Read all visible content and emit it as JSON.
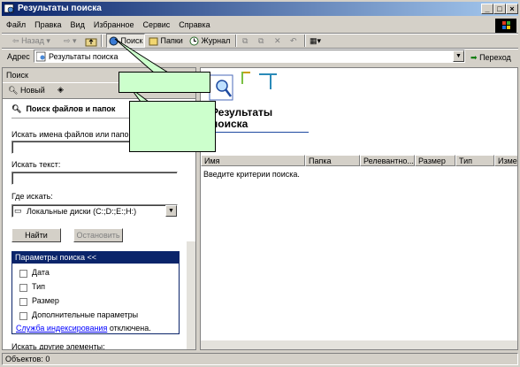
{
  "window": {
    "title": "Результаты поиска"
  },
  "menu": [
    "Файл",
    "Правка",
    "Вид",
    "Избранное",
    "Сервис",
    "Справка"
  ],
  "toolbar": {
    "back": "Назад",
    "search": "Поиск",
    "folders": "Папки",
    "journal": "Журнал"
  },
  "address": {
    "label": "Адрес",
    "value": "Результаты поиска",
    "go": "Переход"
  },
  "left_pane": {
    "header": "Поиск",
    "new_label": "Новый",
    "section_title": "Поиск файлов и папок",
    "names_label": "Искать имена файлов или папок:",
    "names_value": "",
    "text_label": "Искать текст:",
    "text_value": "",
    "where_label": "Где искать:",
    "where_value": "Локальные диски (C:;D:;E:;H:)",
    "find_button": "Найти",
    "stop_button": "Остановить",
    "params_title": "Параметры поиска  <<",
    "params": [
      "Дата",
      "Тип",
      "Размер",
      "Дополнительные параметры"
    ],
    "index_link": "Служба индексирования",
    "index_status": "отключена.",
    "other_label": "Искать другие элементы:"
  },
  "right_pane": {
    "heading_line1": "Результаты",
    "heading_line2": "поиска",
    "columns": [
      "Имя",
      "Папка",
      "Релевантно...",
      "Размер",
      "Тип",
      "Измен"
    ],
    "empty_message": "Введите критерии поиска."
  },
  "status": {
    "text": "Объектов: 0"
  },
  "colors": {
    "title_start": "#0a246a",
    "title_end": "#a6caf0",
    "callout": "#ccffcc",
    "link": "#0000ff"
  }
}
